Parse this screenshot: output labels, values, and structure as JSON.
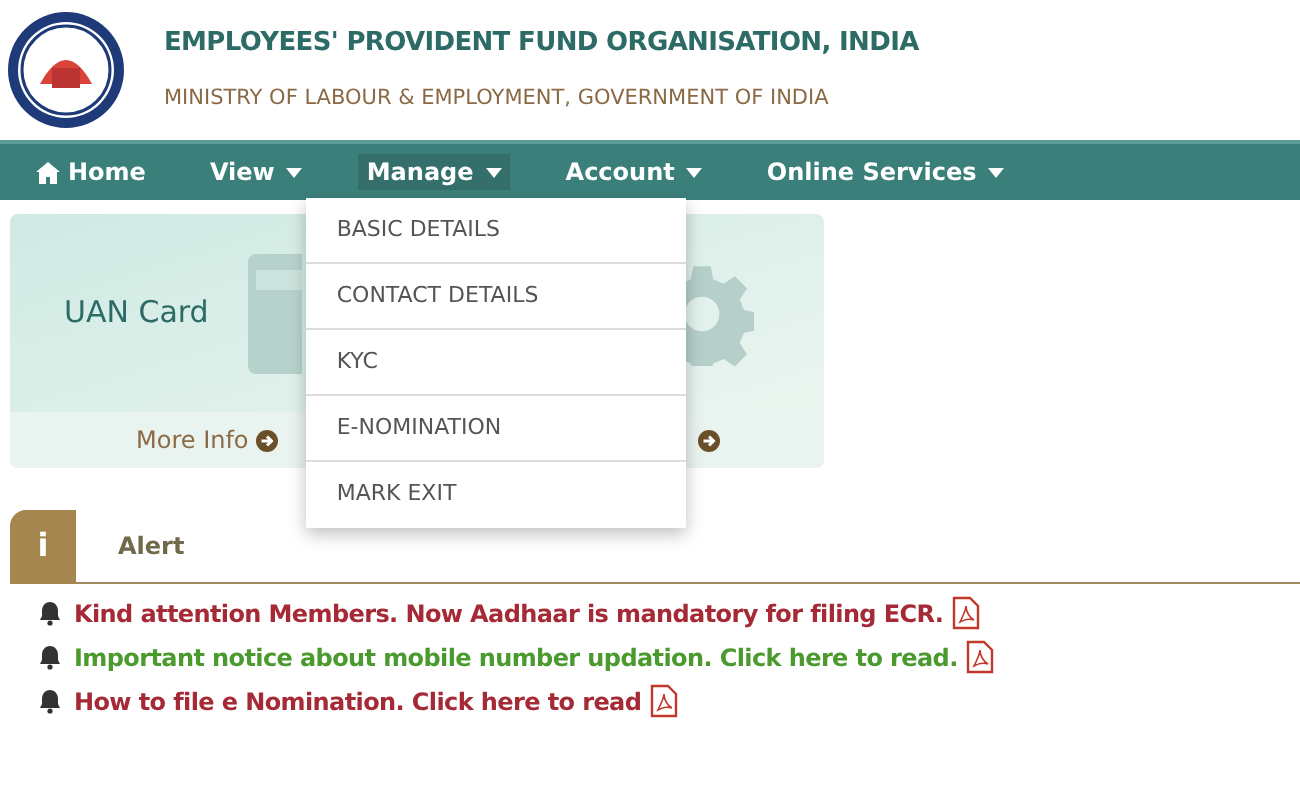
{
  "header": {
    "title": "EMPLOYEES' PROVIDENT FUND ORGANISATION, INDIA",
    "subtitle": "MINISTRY OF LABOUR & EMPLOYMENT, GOVERNMENT OF INDIA"
  },
  "nav": [
    {
      "label": "Home",
      "kind": "home",
      "expanded": false
    },
    {
      "label": "View",
      "kind": "menu",
      "expanded": false
    },
    {
      "label": "Manage",
      "kind": "menu",
      "expanded": true,
      "items": [
        "BASIC DETAILS",
        "CONTACT DETAILS",
        "KYC",
        "E-NOMINATION",
        "MARK EXIT"
      ]
    },
    {
      "label": "Account",
      "kind": "menu",
      "expanded": false
    },
    {
      "label": "Online Services",
      "kind": "menu",
      "expanded": false
    }
  ],
  "card": {
    "title": "UAN Card",
    "link": "More Info"
  },
  "alert_panel": {
    "tab": "Alert",
    "tab_icon": "i",
    "items": [
      {
        "text": "Kind attention Members. Now Aadhaar is mandatory for filing ECR.",
        "color": "#a52a35"
      },
      {
        "text": "Important notice about mobile number updation. Click here to read.",
        "color": "#4a9a2e"
      },
      {
        "text": "How to file e Nomination. Click here to read",
        "color": "#a52a35"
      }
    ]
  }
}
